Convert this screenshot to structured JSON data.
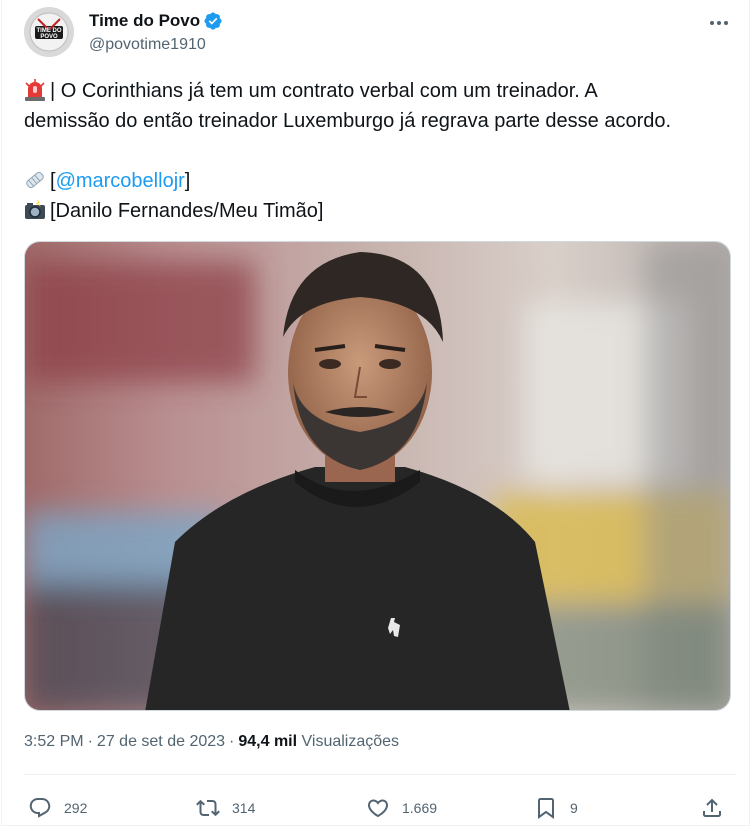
{
  "author": {
    "display_name": "Time do Povo",
    "handle": "@povotime1910",
    "avatar_text_top": "TIME DO",
    "avatar_text_bottom": "POVO",
    "verified": true
  },
  "tweet": {
    "line1": "| O Corinthians já tem um contrato verbal com um treinador. A",
    "line2": "demissão do então treinador Luxemburgo já regrava parte desse acordo.",
    "source_prefix": "[",
    "mention": "@marcobellojr",
    "source_suffix": "]",
    "photo_credit": "[Danilo Fernandes/Meu Timão]"
  },
  "meta": {
    "time": "3:52 PM",
    "date": "27 de set de 2023",
    "views_count": "94,4 mil",
    "views_label": "Visualizações"
  },
  "actions": {
    "replies": "292",
    "reposts": "314",
    "likes": "1.669",
    "bookmarks": "9"
  },
  "colors": {
    "accent": "#1d9bf0",
    "text": "#0f1419",
    "secondary": "#536471",
    "border": "#eff3f4"
  },
  "icons": {
    "verified": "verified-badge-icon",
    "more": "more-icon",
    "siren": "rotating-light-icon",
    "newspaper": "rolled-newspaper-icon",
    "camera": "camera-flash-icon",
    "reply": "reply-icon",
    "repost": "repost-icon",
    "like": "heart-icon",
    "bookmark": "bookmark-icon",
    "share": "share-icon"
  }
}
